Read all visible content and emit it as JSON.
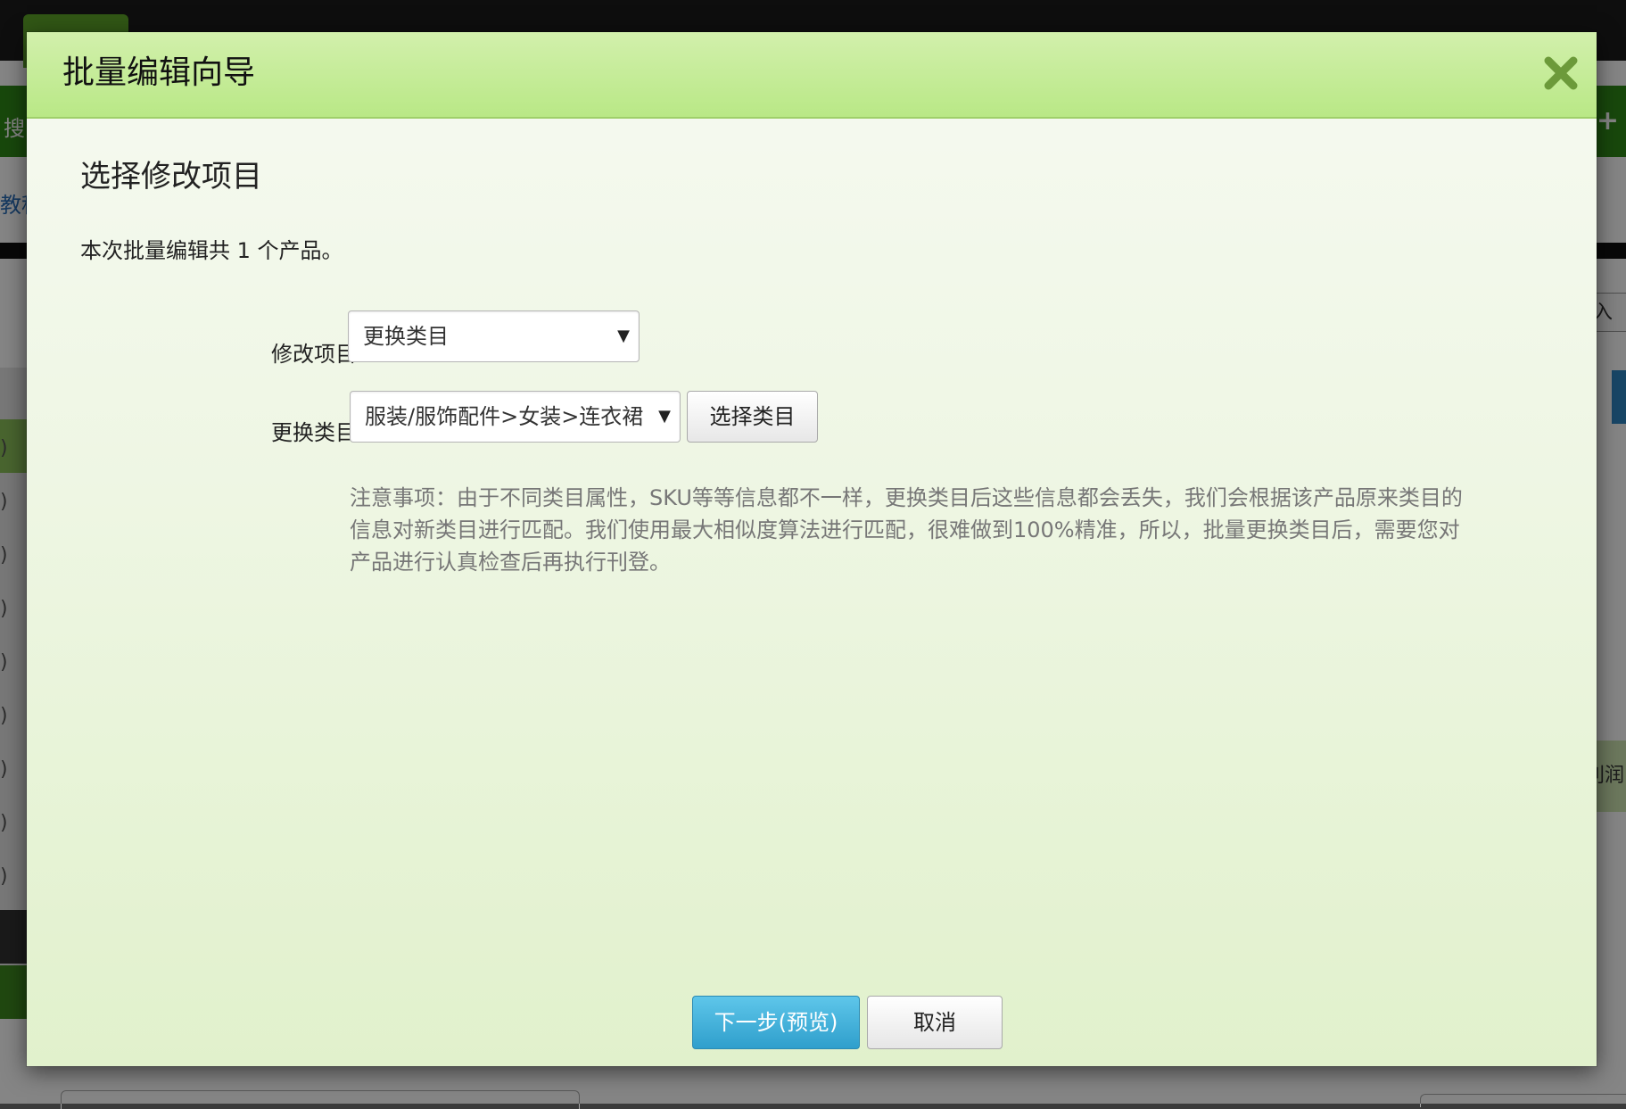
{
  "background": {
    "search_fragment": "搜",
    "tutorial_fragment": "教程",
    "right_input_fragment": "入",
    "profit_fragment": "利润",
    "plus_icon": "+",
    "left_paren": ")"
  },
  "modal": {
    "title": "批量编辑向导",
    "close_icon": "close-icon",
    "section_title": "选择修改项目",
    "summary": "本次批量编辑共 1 个产品。",
    "modify_item_label": "修改项目",
    "modify_item_value": "更换类目",
    "change_category_label": "更换类目",
    "change_category_value": "服装/服饰配件>女装>连衣裙",
    "choose_category_button": "选择类目",
    "caret": "▼",
    "note": "注意事项：由于不同类目属性，SKU等等信息都不一样，更换类目后这些信息都会丢失，我们会根据该产品原来类目的信息对新类目进行匹配。我们使用最大相似度算法进行匹配，很难做到100%精准，所以，批量更换类目后，需要您对产品进行认真检查后再执行刊登。",
    "next_button": "下一步(预览)",
    "cancel_button": "取消"
  },
  "colors": {
    "header_green": "#b9e886",
    "primary_blue": "#2f9fcc",
    "note_gray": "#777777"
  }
}
